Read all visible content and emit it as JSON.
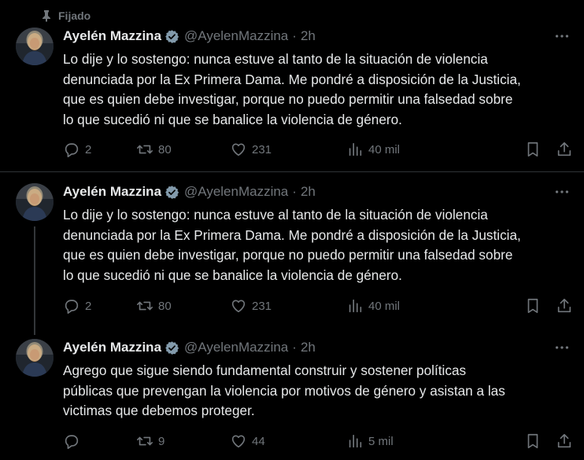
{
  "pinned_label": "Fijado",
  "tweets": [
    {
      "name": "Ayelén Mazzina",
      "handle": "@AyelenMazzina",
      "separator": "·",
      "time": "2h",
      "lines": [
        "Lo dije y lo sostengo: nunca estuve al tanto de la situación de violencia",
        "denunciada por la Ex Primera Dama. Me pondré a disposición de la Justicia,",
        "que es quien debe investigar, porque no puedo permitir una falsedad sobre",
        "lo que sucedió ni que se banalice la violencia de género."
      ],
      "replies": "2",
      "retweets": "80",
      "likes": "231",
      "views": "40 mil"
    },
    {
      "name": "Ayelén Mazzina",
      "handle": "@AyelenMazzina",
      "separator": "·",
      "time": "2h",
      "lines": [
        "Lo dije y lo sostengo: nunca estuve al tanto de la situación de violencia",
        "denunciada por la Ex Primera Dama. Me pondré a disposición de la Justicia,",
        "que es quien debe investigar, porque no puedo permitir una falsedad sobre",
        "lo que sucedió ni que se banalice la violencia de género."
      ],
      "replies": "2",
      "retweets": "80",
      "likes": "231",
      "views": "40 mil"
    },
    {
      "name": "Ayelén Mazzina",
      "handle": "@AyelenMazzina",
      "separator": "·",
      "time": "2h",
      "lines": [
        "Agrego que sigue siendo fundamental construir y sostener políticas",
        "públicas que prevengan la violencia por motivos de género y asistan a las",
        "victimas que debemos proteger."
      ],
      "replies": "",
      "retweets": "9",
      "likes": "44",
      "views": "5 mil"
    }
  ],
  "colors": {
    "background": "#000000",
    "text": "#e7e9ea",
    "muted": "#71767b",
    "verified": "#829aab",
    "divider": "#2f3336"
  }
}
